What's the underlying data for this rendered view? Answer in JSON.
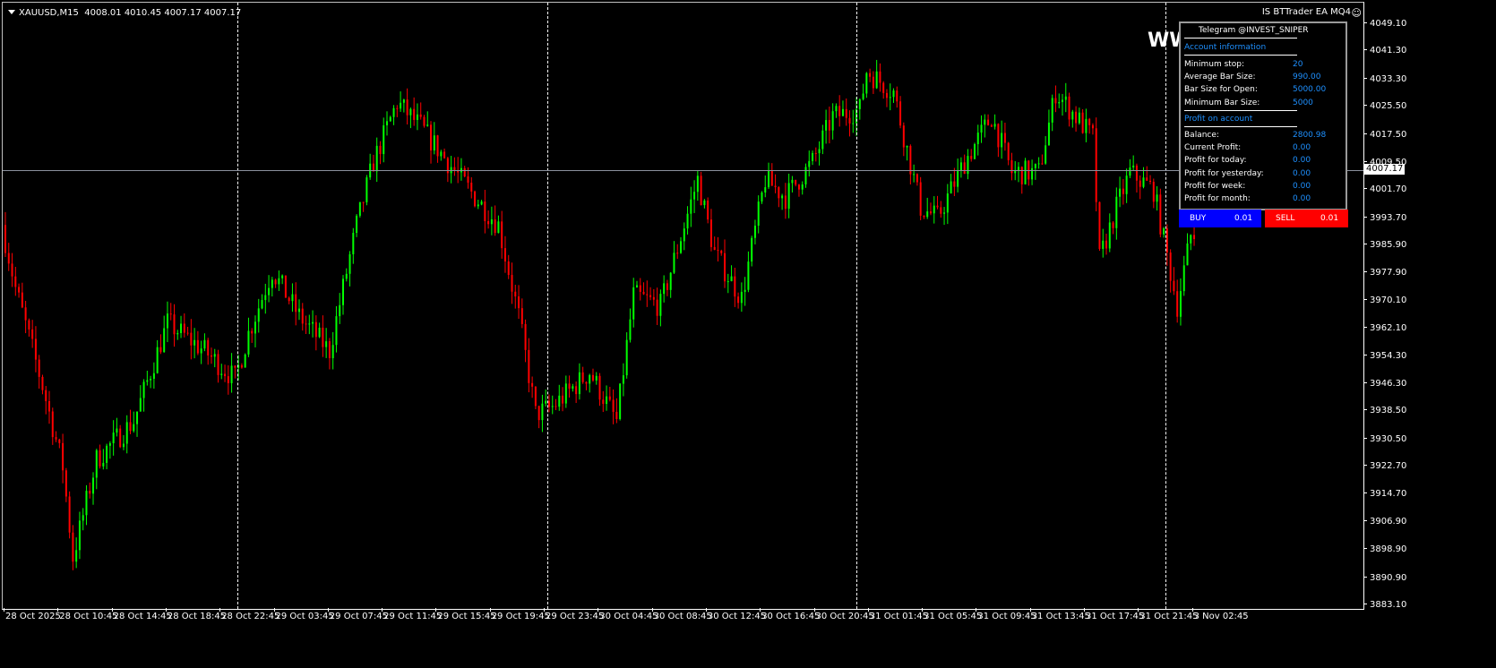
{
  "header": {
    "symbol": "XAUUSD,M15",
    "ohlc": "4008.01 4010.45 4007.17 4007.17"
  },
  "ea_name": "IS BTTrader EA MQ4",
  "overlay_text": "WW",
  "current_price": "4007.17",
  "price_labels": [
    "4049.10",
    "4041.30",
    "4033.30",
    "4025.50",
    "4017.50",
    "4009.50",
    "4001.70",
    "3993.70",
    "3985.90",
    "3977.90",
    "3970.10",
    "3962.10",
    "3954.30",
    "3946.30",
    "3938.50",
    "3930.50",
    "3922.70",
    "3914.70",
    "3906.90",
    "3898.90",
    "3890.90",
    "3883.10"
  ],
  "time_labels": [
    "28 Oct 2025",
    "28 Oct 10:45",
    "28 Oct 14:45",
    "28 Oct 18:45",
    "28 Oct 22:45",
    "29 Oct 03:45",
    "29 Oct 07:45",
    "29 Oct 11:45",
    "29 Oct 15:45",
    "29 Oct 19:45",
    "29 Oct 23:45",
    "30 Oct 04:45",
    "30 Oct 08:45",
    "30 Oct 12:45",
    "30 Oct 16:45",
    "30 Oct 20:45",
    "31 Oct 01:45",
    "31 Oct 05:45",
    "31 Oct 09:45",
    "31 Oct 13:45",
    "31 Oct 17:45",
    "31 Oct 21:45",
    "3 Nov 02:45"
  ],
  "panel": {
    "title": "Telegram @INVEST_SNIPER",
    "section1": "Account information",
    "rows1": [
      {
        "label": "Minimum stop:",
        "value": "20"
      },
      {
        "label": "Average Bar Size:",
        "value": "990.00"
      },
      {
        "label": "Bar Size for Open:",
        "value": "5000.00"
      },
      {
        "label": "Minimum Bar Size:",
        "value": "5000"
      }
    ],
    "section2": "Profit on account",
    "rows2": [
      {
        "label": "Balance:",
        "value": "2800.98"
      },
      {
        "label": "Current Profit:",
        "value": "0.00"
      },
      {
        "label": "Profit for today:",
        "value": "0.00"
      },
      {
        "label": "Profit for yesterday:",
        "value": "0.00"
      },
      {
        "label": "Profit for week:",
        "value": "0.00"
      },
      {
        "label": "Profit for month:",
        "value": "0.00"
      }
    ]
  },
  "buttons": {
    "buy_label": "BUY",
    "buy_lot": "0.01",
    "sell_label": "SELL",
    "sell_lot": "0.01"
  },
  "colors": {
    "bull": "#00ff00",
    "bear": "#ff0000",
    "buy": "#0000ff",
    "sell": "#ff0000"
  },
  "chart_data": {
    "type": "candlestick",
    "symbol": "XAUUSD",
    "timeframe": "M15",
    "ylim": [
      3883.1,
      4049.1
    ],
    "path": [
      [
        0,
        3992
      ],
      [
        4,
        3974
      ],
      [
        12,
        3946
      ],
      [
        18,
        3923
      ],
      [
        21,
        3897
      ],
      [
        28,
        3925
      ],
      [
        39,
        3936
      ],
      [
        49,
        3964
      ],
      [
        60,
        3956
      ],
      [
        69,
        3948
      ],
      [
        73,
        3961
      ],
      [
        80,
        3979
      ],
      [
        88,
        3966
      ],
      [
        97,
        3956
      ],
      [
        105,
        3992
      ],
      [
        110,
        4010
      ],
      [
        117,
        4027
      ],
      [
        124,
        4020
      ],
      [
        132,
        4010
      ],
      [
        140,
        4000
      ],
      [
        147,
        3992
      ],
      [
        153,
        3966
      ],
      [
        158,
        3938
      ],
      [
        163,
        3940
      ],
      [
        174,
        3950
      ],
      [
        182,
        3936
      ],
      [
        187,
        3972
      ],
      [
        195,
        3969
      ],
      [
        206,
        4005
      ],
      [
        211,
        3984
      ],
      [
        219,
        3971
      ],
      [
        226,
        4005
      ],
      [
        232,
        4000
      ],
      [
        240,
        4010
      ],
      [
        246,
        4023
      ],
      [
        254,
        4025
      ],
      [
        256,
        4036
      ],
      [
        264,
        4030
      ],
      [
        272,
        3997
      ],
      [
        277,
        3994
      ],
      [
        285,
        4010
      ],
      [
        293,
        4023
      ],
      [
        299,
        4007
      ],
      [
        307,
        4007
      ],
      [
        312,
        4030
      ],
      [
        323,
        4017
      ],
      [
        325,
        3982
      ],
      [
        330,
        3997
      ],
      [
        334,
        4007
      ],
      [
        341,
        4002
      ],
      [
        348,
        3969
      ],
      [
        352,
        3989
      ]
    ]
  }
}
